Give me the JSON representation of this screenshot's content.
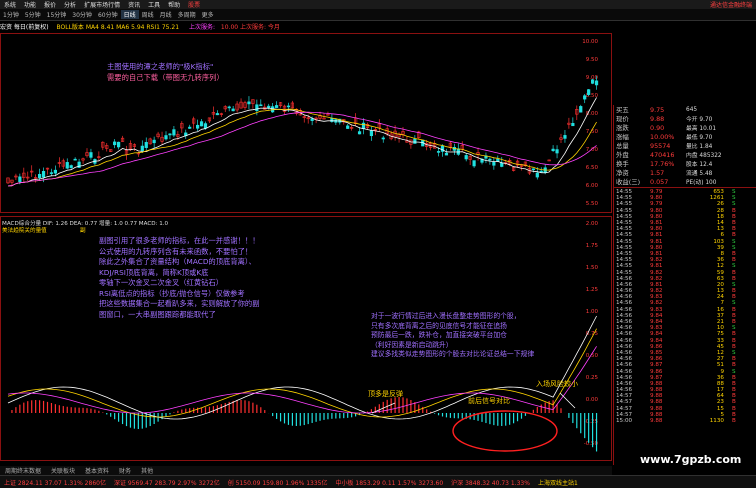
{
  "menu": {
    "items": [
      "系统",
      "功能",
      "报价",
      "分析",
      "扩展市场行情",
      "资讯",
      "工具",
      "帮助",
      "股票"
    ],
    "right": "通达信金融终端"
  },
  "toolbar": {
    "periods": [
      "1分钟",
      "5分钟",
      "15分钟",
      "30分钟",
      "60分钟",
      "日线",
      "周线",
      "月线",
      "多周期",
      "更多"
    ],
    "active": "日线"
  },
  "title": {
    "stock": "宏资 每日(前复权)",
    "ma": "BOLL版本 MA4 8.41 MA6 5.94 RSI1 75.21",
    "event": "上次服务:",
    "price": "10.00 上次服务: 今月"
  },
  "annotations": {
    "top_note_1": "主图使用的潭之老师的\"极K指标\"",
    "top_note_2": "需要的自己下载（带图无九转序列）",
    "mid_note": [
      "副图引用了很多老师的指标，在此一并感谢！！！",
      "公式使用的九转序列含有未来函数，不要怕了！",
      "除此之外集合了资量结构（MACD的顶底背离）、",
      "KDJ/RSI顶底背离，简称K顶或K底",
      "零轴下一次金叉二次金叉（红黄钻石）",
      "RSI离低点的指标（抄底/抛仓信号）仅做参考",
      "把这些数据集合一起看趴多来，实则解放了你的副",
      "图窗口，一大串副图跟踪都能取代了"
    ],
    "right_note": [
      "对于一波行情过后进入漫长盘整走势图形的个股，",
      "只有多次底背离之后的见底信号才能征在追扬",
      "预防最后一跌，跌补仓，加直接突破平台加仓",
      "（利好因素是新启动跳升）",
      "建议多找类似走势图形的个股去对比论证总结一下规律"
    ],
    "label_top_rebound": "顶多是反弹",
    "label_front_back": "前后信号对比",
    "label_entry": "入场风险较小",
    "macd_title": "MACD综合分量 DIF: 1.26 DEA: 0.77 增量: 1.0 0.77 MACD: 1.0",
    "sub_title": "美法趋院关的量值",
    "sub_title2": "副"
  },
  "axis_left": {
    "main": [
      "10.00",
      "9.50",
      "9.00",
      "8.50",
      "8.00",
      "7.50",
      "7.00",
      "6.50",
      "6.00",
      "5.50"
    ],
    "sub": [
      "2.00",
      "1.75",
      "1.50",
      "1.25",
      "1.00",
      "0.75",
      "0.50",
      "0.25",
      "0.00",
      "-0.25",
      "-0.50"
    ]
  },
  "quote": {
    "rows": [
      {
        "k": "买五",
        "v": "9.75",
        "n": "645"
      },
      {
        "k": "现价",
        "v": "9.88",
        "n": "今开 9.70"
      },
      {
        "k": "涨跌",
        "v": "0.90",
        "n": "最高 10.01"
      },
      {
        "k": "涨幅",
        "v": "10.00%",
        "n": "最低 9.70"
      },
      {
        "k": "总量",
        "v": "95574",
        "n": "量比 1.84"
      },
      {
        "k": "外盘",
        "v": "470416",
        "n": "内盘 485322"
      },
      {
        "k": "换手",
        "v": "17.76%",
        "n": "股本 12.4"
      },
      {
        "k": "净资",
        "v": "1.57",
        "n": "流通 5.48"
      },
      {
        "k": "收益(三)",
        "v": "0.057",
        "n": "PE(动) 100"
      }
    ],
    "ticks": [
      [
        "14:55",
        "9.79",
        "653",
        "S"
      ],
      [
        "14:55",
        "9.80",
        "1261",
        "S"
      ],
      [
        "14:55",
        "9.79",
        "26",
        "S"
      ],
      [
        "14:55",
        "9.80",
        "28",
        "B"
      ],
      [
        "14:55",
        "9.80",
        "18",
        "B"
      ],
      [
        "14:55",
        "9.81",
        "14",
        "B"
      ],
      [
        "14:55",
        "9.80",
        "13",
        "B"
      ],
      [
        "14:55",
        "9.81",
        "6",
        "B"
      ],
      [
        "14:55",
        "9.81",
        "103",
        "S"
      ],
      [
        "14:55",
        "9.80",
        "39",
        "S"
      ],
      [
        "14:55",
        "9.81",
        "8",
        "B"
      ],
      [
        "14:55",
        "9.82",
        "36",
        "B"
      ],
      [
        "14:55",
        "9.81",
        "12",
        "S"
      ],
      [
        "14:55",
        "9.82",
        "59",
        "B"
      ],
      [
        "14:56",
        "9.82",
        "63",
        "B"
      ],
      [
        "14:56",
        "9.81",
        "20",
        "S"
      ],
      [
        "14:56",
        "9.82",
        "13",
        "B"
      ],
      [
        "14:56",
        "9.83",
        "24",
        "B"
      ],
      [
        "14:56",
        "9.82",
        "7",
        "S"
      ],
      [
        "14:56",
        "9.83",
        "16",
        "B"
      ],
      [
        "14:56",
        "9.84",
        "37",
        "B"
      ],
      [
        "14:56",
        "9.84",
        "21",
        "B"
      ],
      [
        "14:56",
        "9.83",
        "10",
        "S"
      ],
      [
        "14:56",
        "9.84",
        "75",
        "B"
      ],
      [
        "14:56",
        "9.84",
        "33",
        "B"
      ],
      [
        "14:56",
        "9.86",
        "45",
        "B"
      ],
      [
        "14:56",
        "9.85",
        "12",
        "S"
      ],
      [
        "14:56",
        "9.86",
        "27",
        "B"
      ],
      [
        "14:56",
        "9.87",
        "51",
        "B"
      ],
      [
        "14:56",
        "9.86",
        "9",
        "S"
      ],
      [
        "14:56",
        "9.87",
        "36",
        "B"
      ],
      [
        "14:56",
        "9.88",
        "88",
        "B"
      ],
      [
        "14:56",
        "9.88",
        "17",
        "B"
      ],
      [
        "14:57",
        "9.88",
        "64",
        "B"
      ],
      [
        "14:57",
        "9.88",
        "23",
        "B"
      ],
      [
        "14:57",
        "9.88",
        "15",
        "B"
      ],
      [
        "14:57",
        "9.88",
        "5",
        "B"
      ],
      [
        "15:00",
        "9.88",
        "1130",
        "B"
      ]
    ]
  },
  "tabs": [
    "周期终末数据",
    "关联板块",
    "基本资料",
    "财务",
    "其他"
  ],
  "statusbar": [
    {
      "t": "上证 2824.11 37.07 1.31% 2860亿",
      "c": "#ff4040"
    },
    {
      "t": "深证 9569.47 283.79 2.97% 3272亿",
      "c": "#ff4040"
    },
    {
      "t": "创 5150.09 159.80 1.96% 1335亿",
      "c": "#ff4040"
    },
    {
      "t": "中小板 1853.29 0.11 1.57% 3273.60",
      "c": "#ff4040"
    },
    {
      "t": "沪深 3848.32 40.73 1.33%",
      "c": "#ff4040"
    },
    {
      "t": "上海双线主站1",
      "c": "#ffd400"
    }
  ],
  "watermark": "www.7gpzb.com",
  "colors": {
    "up": "#ff3030",
    "down": "#20e0e0",
    "ma1": "#ffffff",
    "ma2": "#ffd400",
    "ma3": "#ff40ff",
    "note": "#a070ff"
  }
}
